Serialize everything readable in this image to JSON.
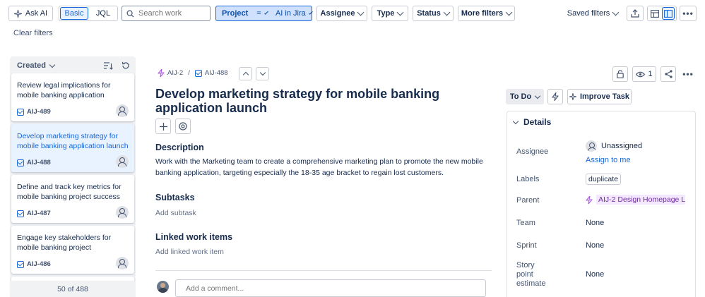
{
  "toolbar": {
    "ask_ai": "Ask AI",
    "mode_basic": "Basic",
    "mode_jql": "JQL",
    "search_placeholder": "Search work",
    "project_filter": {
      "label": "Project",
      "operator": "=",
      "value": "AI in Jira"
    },
    "assignee": "Assignee",
    "type": "Type",
    "status": "Status",
    "more_filters": "More filters",
    "saved_filters": "Saved filters",
    "clear_filters": "Clear filters"
  },
  "list": {
    "sort_label": "Created",
    "items": [
      {
        "title": "Review legal implications for mobile banking application",
        "key": "AIJ-489",
        "selected": false
      },
      {
        "title": "Develop marketing strategy for mobile banking application launch",
        "key": "AIJ-488",
        "selected": true
      },
      {
        "title": "Define and track key metrics for mobile banking project success",
        "key": "AIJ-487",
        "selected": false
      },
      {
        "title": "Engage key stakeholders for mobile banking project",
        "key": "AIJ-486",
        "selected": false
      }
    ],
    "pagination": "50 of 488"
  },
  "issue": {
    "breadcrumb_parent": "AIJ-2",
    "breadcrumb_sep": "/",
    "breadcrumb_key": "AIJ-488",
    "title": "Develop marketing strategy for mobile banking application launch",
    "description_heading": "Description",
    "description": "Work with the Marketing team to create a comprehensive marketing plan to promote the new mobile banking application, targeting especially the 18-35 age bracket to regain lost customers.",
    "subtasks_heading": "Subtasks",
    "add_subtask": "Add subtask",
    "linked_heading": "Linked work items",
    "add_linked": "Add linked work item",
    "comment_placeholder": "Add a comment..."
  },
  "side": {
    "watchers": "1",
    "status": "To Do",
    "improve_task": "Improve Task",
    "details_heading": "Details",
    "assignee_label": "Assignee",
    "assignee_value": "Unassigned",
    "assign_to_me": "Assign to me",
    "labels_label": "Labels",
    "label_value": "duplicate",
    "parent_label": "Parent",
    "parent_value": "AIJ-2 Design Homepage L",
    "team_label": "Team",
    "team_value": "None",
    "sprint_label": "Sprint",
    "sprint_value": "None",
    "story_points_label_1": "Story",
    "story_points_label_2": "point",
    "story_points_label_3": "estimate",
    "story_points_value": "None"
  },
  "colors": {
    "accent": "#1868db",
    "selected_bg": "#e9f2ff",
    "ai_purple": "#af59e1",
    "parent_bg": "#f3e8fd"
  }
}
